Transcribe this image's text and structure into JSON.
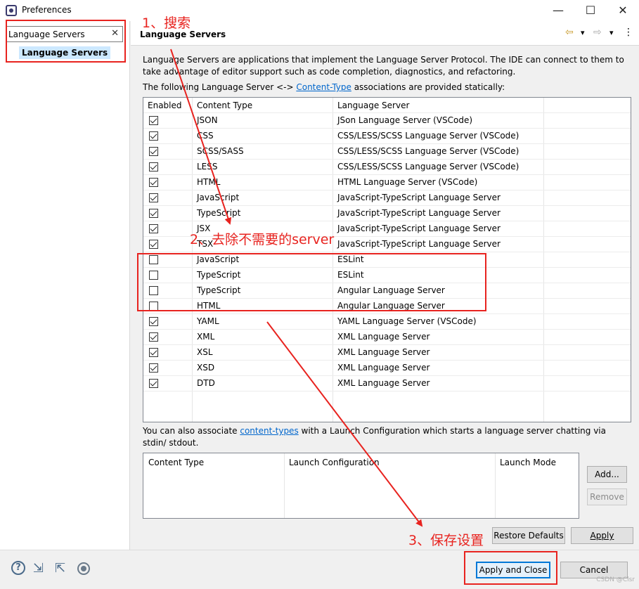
{
  "window": {
    "title": "Preferences",
    "minimize": "—",
    "maximize": "☐",
    "close": "✕"
  },
  "sidebar": {
    "filter_value": "Language Servers",
    "filter_clear": "✕",
    "selected_item": "Language Servers"
  },
  "page": {
    "title": "Language Servers",
    "nav_back": "⇦",
    "nav_back_menu": "▾",
    "nav_forward": "⇨",
    "nav_forward_menu": "▾",
    "view_menu": "⋮",
    "description": "Language Servers are applications that implement the Language Server Protocol. The IDE can connect to them to take advantage of editor support such as code completion, diagnostics, and refactoring.",
    "assoc_prefix": "The following Language Server <-> ",
    "assoc_link": "Content-Type",
    "assoc_suffix": " associations are provided statically:"
  },
  "table": {
    "headers": {
      "enabled": "Enabled",
      "content_type": "Content Type",
      "language_server": "Language Server"
    },
    "rows": [
      {
        "enabled": true,
        "content_type": "JSON",
        "server": "JSon Language Server (VSCode)"
      },
      {
        "enabled": true,
        "content_type": "CSS",
        "server": "CSS/LESS/SCSS Language Server (VSCode)"
      },
      {
        "enabled": true,
        "content_type": "SCSS/SASS",
        "server": "CSS/LESS/SCSS Language Server (VSCode)"
      },
      {
        "enabled": true,
        "content_type": "LESS",
        "server": "CSS/LESS/SCSS Language Server (VSCode)"
      },
      {
        "enabled": true,
        "content_type": "HTML",
        "server": "HTML Language Server (VSCode)"
      },
      {
        "enabled": true,
        "content_type": "JavaScript",
        "server": "JavaScript-TypeScript Language Server"
      },
      {
        "enabled": true,
        "content_type": "TypeScript",
        "server": "JavaScript-TypeScript Language Server"
      },
      {
        "enabled": true,
        "content_type": "JSX",
        "server": "JavaScript-TypeScript Language Server"
      },
      {
        "enabled": true,
        "content_type": "TSX",
        "server": "JavaScript-TypeScript Language Server"
      },
      {
        "enabled": false,
        "content_type": "JavaScript",
        "server": "ESLint"
      },
      {
        "enabled": false,
        "content_type": "TypeScript",
        "server": "ESLint"
      },
      {
        "enabled": false,
        "content_type": "TypeScript",
        "server": "Angular Language Server"
      },
      {
        "enabled": false,
        "content_type": "HTML",
        "server": "Angular Language Server"
      },
      {
        "enabled": true,
        "content_type": "YAML",
        "server": "YAML Language Server (VSCode)"
      },
      {
        "enabled": true,
        "content_type": "XML",
        "server": "XML Language Server"
      },
      {
        "enabled": true,
        "content_type": "XSL",
        "server": "XML Language Server"
      },
      {
        "enabled": true,
        "content_type": "XSD",
        "server": "XML Language Server"
      },
      {
        "enabled": true,
        "content_type": "DTD",
        "server": "XML Language Server"
      }
    ]
  },
  "launch": {
    "prefix": "You can also associate ",
    "link": "content-types",
    "suffix": " with a Launch Configuration which starts a language server chatting via stdin/ stdout.",
    "headers": {
      "content_type": "Content Type",
      "launch_configuration": "Launch Configuration",
      "launch_mode": "Launch Mode"
    }
  },
  "buttons": {
    "add": "Add...",
    "remove": "Remove",
    "restore_defaults": "Restore Defaults",
    "apply": "Apply",
    "apply_and_close": "Apply and Close",
    "cancel": "Cancel"
  },
  "bottom_icons": [
    "help-icon",
    "import-icon",
    "export-icon",
    "record-icon"
  ],
  "watermark": "CSDN @Clsr",
  "annotations": {
    "step1": "1、搜索",
    "step2": "2、去除不需要的server",
    "step3": "3、保存设置",
    "color": "#e8231f"
  }
}
